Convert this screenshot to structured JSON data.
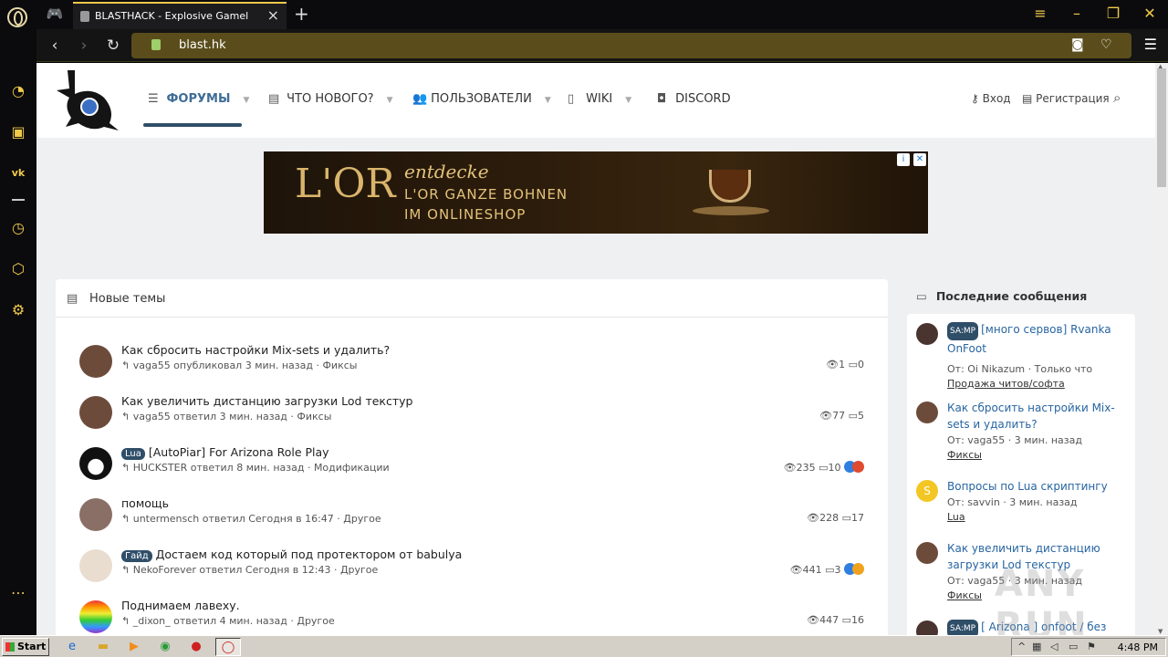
{
  "browser": {
    "tab_title": "BLASTHACK - Explosive Gamel",
    "url": "blast.hk",
    "accent": "#f0c94a"
  },
  "site": {
    "nav": [
      {
        "label": "ФОРУМЫ",
        "icon": "forum-icon",
        "active": true
      },
      {
        "label": "ЧТО НОВОГО?",
        "icon": "whats-new-icon"
      },
      {
        "label": "ПОЛЬЗОВАТЕЛИ",
        "icon": "users-icon"
      },
      {
        "label": "WIKI",
        "icon": "wiki-icon"
      },
      {
        "label": "DISCORD",
        "icon": "discord-icon"
      }
    ],
    "login": "Вход",
    "register": "Регистрация"
  },
  "ad": {
    "brand": "L'OR",
    "line1": "entdecke",
    "line2": "L'OR GANZE BOHNEN",
    "line3": "IM ONLINESHOP"
  },
  "new_threads": {
    "title": "Новые темы",
    "items": [
      {
        "prefix": "",
        "title": "Как сбросить настройки Mix-sets и удалить?",
        "meta": "vaga55 опубликовал 3 мин. назад · Фиксы",
        "views": "1",
        "replies": "0"
      },
      {
        "prefix": "",
        "title": "Как увеличить дистанцию загрузки Lod текстур",
        "meta": "vaga55 ответил 3 мин. назад · Фиксы",
        "views": "77",
        "replies": "5"
      },
      {
        "prefix": "Lua",
        "title": "[AutoPiar] For Arizona Role Play",
        "meta": "HUCKSTER ответил 8 мин. назад · Модификации",
        "views": "235",
        "replies": "10"
      },
      {
        "prefix": "",
        "title": "помощь",
        "meta": "untermensch ответил Сегодня в 16:47 · Другое",
        "views": "228",
        "replies": "17"
      },
      {
        "prefix": "Гайд",
        "title": "Достаем код который под протектором от babulya",
        "meta": "NekoForever ответил Сегодня в 12:43 · Другое",
        "views": "441",
        "replies": "3"
      },
      {
        "prefix": "",
        "title": "Поднимаем лавеху.",
        "meta": "_dixon_ ответил 4 мин. назад · Другое",
        "views": "447",
        "replies": "16"
      }
    ]
  },
  "latest_posts": {
    "title": "Последние сообщения",
    "items": [
      {
        "prefix": "SA:MP",
        "title": "[много сервов] Rvanka OnFoot",
        "by": "От: Oi Nikazum · Только что",
        "category": "Продажа читов/софта"
      },
      {
        "prefix": "",
        "title": "Как сбросить настройки Mix-sets и удалить?",
        "by": "От: vaga55 · 3 мин. назад",
        "category": "Фиксы"
      },
      {
        "prefix": "",
        "title": "Вопросы по Lua скриптингу",
        "by": "От: savvin · 3 мин. назад",
        "category": "Lua",
        "avatar_letter": "S"
      },
      {
        "prefix": "",
        "title": "Как увеличить дистанцию загрузки Lod текстур",
        "by": "От: vaga55 · 3 мин. назад",
        "category": "Фиксы"
      },
      {
        "prefix": "SA:MP",
        "title": "[ Arizona ] onfoot / без",
        "by": "",
        "category": ""
      }
    ]
  },
  "watermark": "ANY RUN",
  "taskbar": {
    "start": "Start",
    "clock": "4:48 PM"
  }
}
